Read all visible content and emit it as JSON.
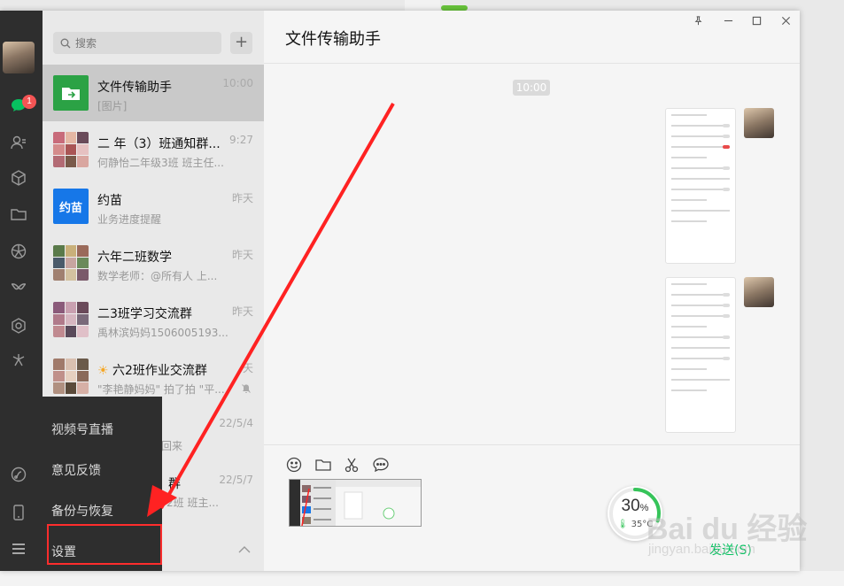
{
  "search": {
    "placeholder": "搜索",
    "add_label": "+"
  },
  "rail": {
    "badge_count": "1"
  },
  "chats": [
    {
      "name": "文件传输助手",
      "preview": "[图片]",
      "time": "10:00"
    },
    {
      "name": "二  年（3）班通知群...",
      "preview": "何静怡二年级3班 班主任...",
      "time": "9:27"
    },
    {
      "name": "约苗",
      "preview": "业务进度提醒",
      "time": "昨天",
      "logo": "约苗"
    },
    {
      "name": "六年二班数学",
      "preview": "数学老师：@所有人 上...",
      "time": "昨天"
    },
    {
      "name": "二3班学习交流群",
      "preview": "禹林滨妈妈1506005193...",
      "time": "昨天"
    },
    {
      "name": "六2班作业交流群",
      "preview": "\"李艳静妈妈\" 拍了拍 \"平...",
      "time": "天"
    },
    {
      "name": "",
      "preview": "回来",
      "time": "22/5/4"
    },
    {
      "name": "群",
      "preview": "2班 班主...",
      "time": "22/5/7"
    }
  ],
  "menu": {
    "items": [
      "视频号直播",
      "意见反馈",
      "备份与恢复",
      "设置"
    ]
  },
  "chat": {
    "title": "文件传输助手",
    "time_divider": "10:00",
    "send_label": "发送(S)"
  },
  "gauge": {
    "percent": 30,
    "percent_unit": "%",
    "temperature": "35°C"
  },
  "watermark": {
    "main": "Bai du 经验",
    "sub": "jingyan.baidu.com"
  },
  "colors": {
    "rail": "#2e2e2e",
    "accent": "#07c160",
    "badge": "#f45454",
    "highlight": "#ff2d2d",
    "arrow": "#ff2222"
  }
}
